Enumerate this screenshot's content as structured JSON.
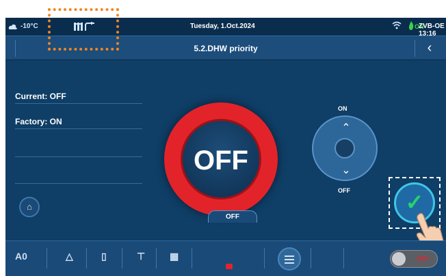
{
  "status": {
    "temperature": "-10°C",
    "date": "Tuesday, 1.Oct.2024",
    "badge": "ON",
    "device": "ZVB-OE 13:16"
  },
  "header": {
    "title": "5.2.DHW priority",
    "back_icon": "chevron-left-icon"
  },
  "info": {
    "current": "Current: OFF",
    "factory": "Factory: ON"
  },
  "main": {
    "state_label": "OFF",
    "selector_on": "ON",
    "selector_off": "OFF"
  },
  "bottom": {
    "tab_label": "OFF",
    "toggle_label": "OFF"
  },
  "colors": {
    "background": "#0f3e66",
    "accent_red": "#e3232a",
    "confirm_green": "#27d36b"
  }
}
